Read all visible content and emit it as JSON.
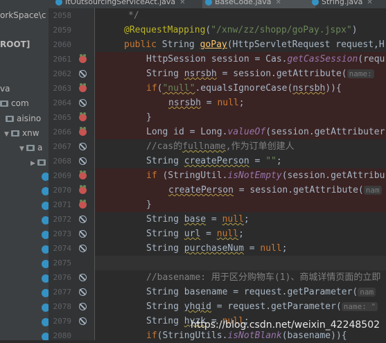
{
  "tabs": [
    {
      "label": "ItOutsourcingServiceAct.java",
      "active": false
    },
    {
      "label": "BaseCode.java",
      "active": true
    },
    {
      "label": "String.java",
      "active": false
    }
  ],
  "project": {
    "rows": [
      {
        "label": "orkSpace\\c"
      },
      {
        "label": "ROOT]"
      },
      {
        "label": "va"
      },
      {
        "label": "com"
      },
      {
        "label": "aisino"
      },
      {
        "label": "xnw"
      },
      {
        "label": "a"
      }
    ]
  },
  "colors": {
    "keyword": "#cc7832",
    "string": "#6a8759",
    "annotation": "#bbb529",
    "method": "#ffc66d",
    "comment": "#808080",
    "coverage_marker": "#c75450",
    "covered_bg": "#3a2323"
  },
  "gutter": {
    "line_numbers": [
      "2058",
      "2059",
      "2060",
      "2061",
      "2062",
      "2063",
      "2064",
      "2065",
      "2066",
      "2067",
      "2068",
      "2069",
      "2070",
      "2071",
      "2072",
      "2073",
      "2074",
      "2075",
      "2076",
      "2077",
      "2078",
      "2079",
      "2080"
    ],
    "markers": [
      "none",
      "none",
      "none",
      "coverage-icon",
      "breakpoint-icon",
      "coverage-icon",
      "breakpoint-icon",
      "coverage-icon",
      "coverage-icon",
      "breakpoint-icon",
      "breakpoint-icon",
      "coverage-icon",
      "coverage-icon",
      "coverage-icon",
      "breakpoint-icon",
      "breakpoint-icon",
      "breakpoint-icon",
      "none",
      "breakpoint-icon",
      "breakpoint-icon",
      "breakpoint-icon",
      "breakpoint-icon",
      "none"
    ]
  },
  "code": {
    "l2058": "*/",
    "l2059_ann": "@RequestMapping",
    "l2059_str": "\"/xnw/zz/shopp/goPay.jspx\"",
    "l2060_pub": "public",
    "l2060_type": "String",
    "l2060_fn": "goPay",
    "l2060_rest": "(HttpServletRequest request,H",
    "l2061_a": "HttpSession session = Cas.",
    "l2061_b": "getCasSession",
    "l2061_c": "(requ",
    "l2062_a": "String ",
    "l2062_b": "nsrsbh",
    "l2062_c": " = session.getAttribute(",
    "l2062_hint": "name:",
    "l2063_kw": "if",
    "l2063_a": "(",
    "l2063_str": "\"null\"",
    "l2063_b": ".equalsIgnoreCase(",
    "l2063_c": "nsrsbh",
    "l2063_d": ")){",
    "l2064_a": "nsrsbh",
    "l2064_b": " = ",
    "l2064_kw": "null",
    "l2064_c": ";",
    "l2065": "}",
    "l2066_a": "Long id = Long.",
    "l2066_b": "valueOf",
    "l2066_c": "(session.getAttributer",
    "l2067_cm": "//cas的",
    "l2067_cm2": "fullname",
    "l2067_cm3": ",作为订单创建人",
    "l2068_a": "String ",
    "l2068_b": "createPerson",
    "l2068_c": " = ",
    "l2068_str": "\"\"",
    "l2068_d": ";",
    "l2069_kw": "if",
    "l2069_a": " (StringUtil.",
    "l2069_b": "isNotEmpty",
    "l2069_c": "(session.getAttribu",
    "l2070_a": "createPerson",
    "l2070_b": " = session.getAttribute(",
    "l2070_hint": "nam",
    "l2071": "}",
    "l2072_a": "String ",
    "l2072_b": "base",
    "l2072_c": " = ",
    "l2072_kw": "null",
    "l2072_d": ";",
    "l2073_a": "String ",
    "l2073_b": "url",
    "l2073_c": " = ",
    "l2073_kw": "null",
    "l2073_d": ";",
    "l2074_a": "String ",
    "l2074_b": "purchaseNum",
    "l2074_c": " = ",
    "l2074_kw": "null",
    "l2074_d": ";",
    "l2076_cm": "//basename: 用于区分购物车(1)、商城详情页面的立即",
    "l2077_a": "String basename = request.getParameter(",
    "l2077_hint": "nam",
    "l2078_a": "String ",
    "l2078_b": "yhqid",
    "l2078_c": " = request.getParameter(",
    "l2078_hint": "name: \"",
    "l2079_a": "String ",
    "l2079_b": "hyzk",
    "l2079_c": " = ",
    "l2079_kw": "null",
    "l2079_d": ";",
    "l2080_kw": "if",
    "l2080_a": "(StringUtils.",
    "l2080_b": "isNotBlank",
    "l2080_c": "(basename)){"
  },
  "watermark": "https://blog.csdn.net/weixin_42248502"
}
